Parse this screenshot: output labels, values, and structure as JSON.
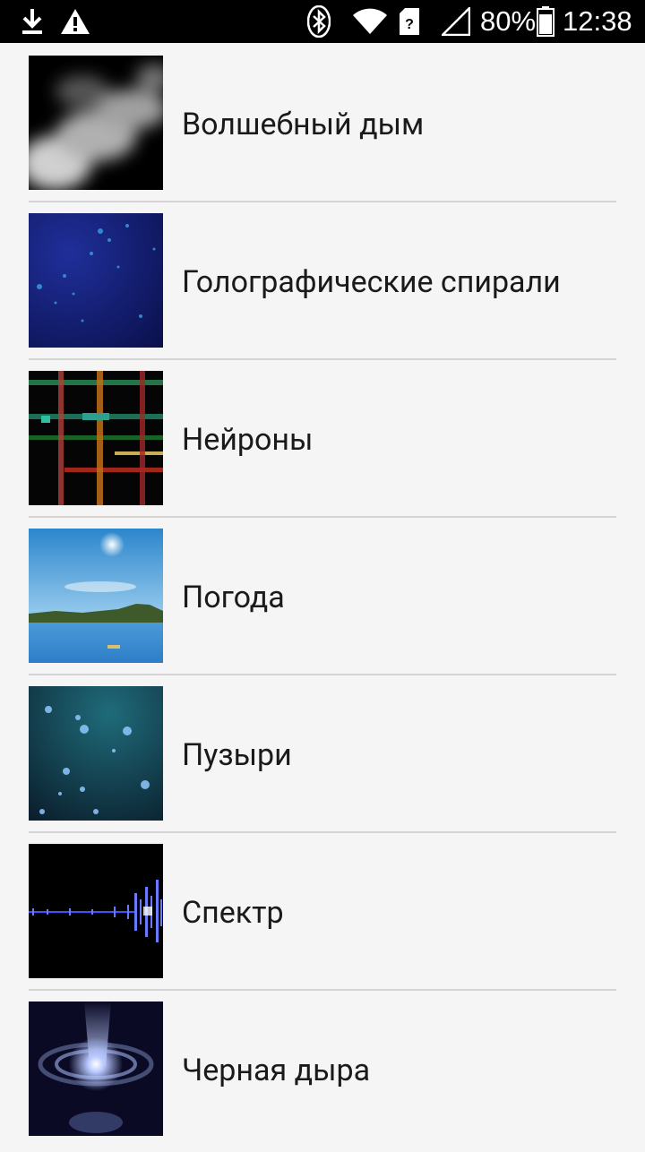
{
  "status_bar": {
    "battery": "80%",
    "time": "12:38",
    "icons": [
      "download-icon",
      "warning-icon",
      "bluetooth-icon",
      "wifi-icon",
      "sim-icon",
      "signal-icon",
      "battery-icon"
    ]
  },
  "items": [
    {
      "label": "Волшебный дым",
      "thumb": "smoke-thumbnail"
    },
    {
      "label": "Голографические спирали",
      "thumb": "holographic-spirals-thumbnail"
    },
    {
      "label": "Нейроны",
      "thumb": "neurons-thumbnail"
    },
    {
      "label": "Погода",
      "thumb": "weather-thumbnail"
    },
    {
      "label": "Пузыри",
      "thumb": "bubbles-thumbnail"
    },
    {
      "label": "Спектр",
      "thumb": "spectrum-thumbnail"
    },
    {
      "label": "Черная дыра",
      "thumb": "black-hole-thumbnail"
    }
  ]
}
